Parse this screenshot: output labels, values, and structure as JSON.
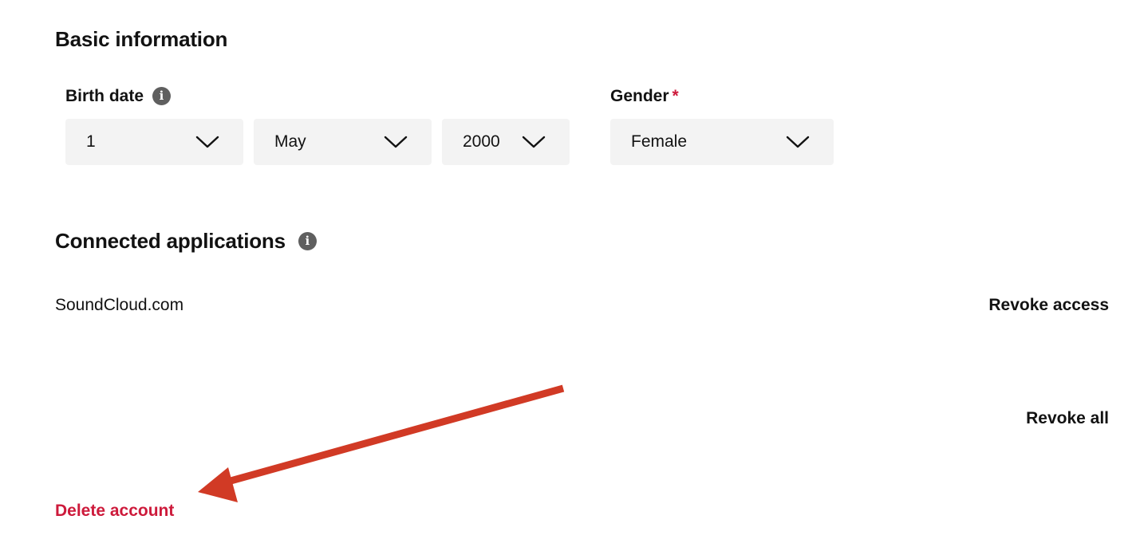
{
  "basic_info": {
    "title": "Basic information",
    "birth_date": {
      "label": "Birth date",
      "info_icon": "info-icon",
      "day": "1",
      "month": "May",
      "year": "2000"
    },
    "gender": {
      "label": "Gender",
      "required_mark": "*",
      "value": "Female"
    }
  },
  "connected_apps": {
    "title": "Connected applications",
    "info_icon": "info-icon",
    "apps": [
      {
        "name": "SoundCloud.com",
        "action": "Revoke access"
      }
    ],
    "revoke_all": "Revoke all"
  },
  "delete_account": "Delete account",
  "annotation": {
    "arrow_color": "#d13a25",
    "arrow_target": "delete-account-link"
  },
  "colors": {
    "danger": "#cd1a3b",
    "select_bg": "#f3f3f3",
    "info_icon_bg": "#5f5f5f"
  }
}
